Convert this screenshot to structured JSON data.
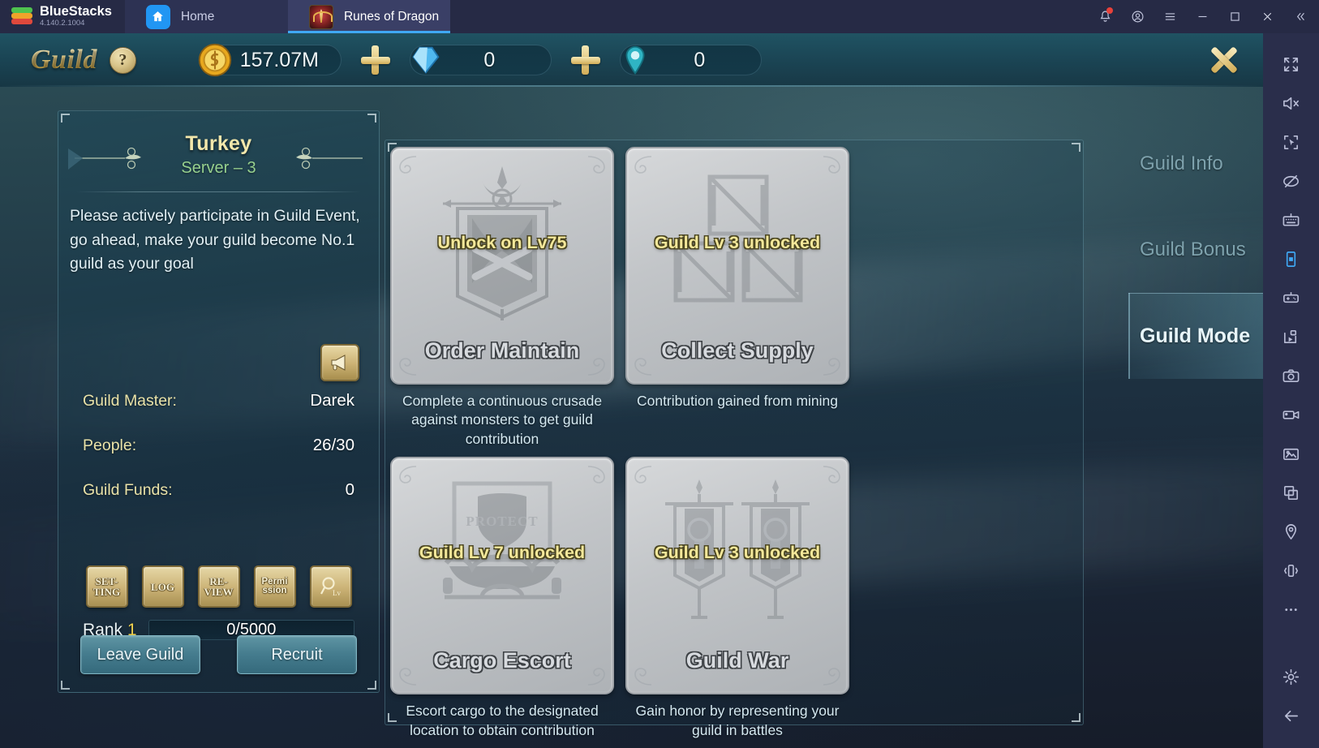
{
  "titlebar": {
    "brand": "BlueStacks",
    "version": "4.140.2.1004",
    "tabs": [
      {
        "label": "Home",
        "icon": "home-icon"
      },
      {
        "label": "Runes of Dragon",
        "icon": "game-app-icon"
      }
    ],
    "controls": [
      {
        "name": "notifications-button",
        "icon": "bell-icon",
        "badge": true
      },
      {
        "name": "account-button",
        "icon": "account-circle-icon"
      },
      {
        "name": "menu-button",
        "icon": "hamburger-icon"
      },
      {
        "name": "minimize-button",
        "icon": "minimize-icon"
      },
      {
        "name": "maximize-button",
        "icon": "maximize-icon"
      },
      {
        "name": "close-button",
        "icon": "close-icon"
      },
      {
        "name": "collapse-button",
        "icon": "double-chevron-left-icon"
      }
    ]
  },
  "game_header": {
    "title": "Guild",
    "help_label": "?",
    "currencies": [
      {
        "name": "gold",
        "icon": "gold-coin-icon",
        "value": "157.07M",
        "add": "+"
      },
      {
        "name": "diamond",
        "icon": "diamond-icon",
        "value": "0",
        "add": "+"
      },
      {
        "name": "gem",
        "icon": "teal-gem-icon",
        "value": "0"
      }
    ],
    "close_label": "X"
  },
  "guild_info": {
    "name": "Turkey",
    "server": "Server – 3",
    "notice": "Please actively participate in Guild Event, go ahead, make your guild become No.1 guild as your goal",
    "announce_icon": "megaphone-icon",
    "stats": [
      {
        "label": "Guild Master:",
        "value": "Darek"
      },
      {
        "label": "People:",
        "value": "26/30"
      },
      {
        "label": "Guild Funds:",
        "value": "0"
      }
    ],
    "function_buttons": [
      {
        "name": "setting-button",
        "line1": "SET-",
        "line2": "TING",
        "icon": null
      },
      {
        "name": "log-button",
        "line1": "LOG",
        "line2": "",
        "icon": null
      },
      {
        "name": "review-button",
        "line1": "RE-",
        "line2": "VIEW",
        "icon": null
      },
      {
        "name": "permission-button",
        "line1": "Permi",
        "line2": "ssion",
        "icon": null
      },
      {
        "name": "level-search-button",
        "line1": "",
        "line2": "",
        "icon": "magnifier-lv-icon"
      }
    ],
    "rank_label": "Rank",
    "rank_value": "1",
    "rank_progress": "0/5000",
    "actions": [
      {
        "name": "leave-guild-button",
        "label": "Leave Guild"
      },
      {
        "name": "recruit-button",
        "label": "Recruit"
      }
    ]
  },
  "guild_modes": [
    {
      "name": "Order Maintain",
      "lock": "Unlock on Lv75",
      "desc": "Complete a continuous crusade against monsters to get guild contribution",
      "icon": "banner-swords-icon"
    },
    {
      "name": "Collect Supply",
      "lock": "Guild Lv 3 unlocked",
      "desc": "Contribution gained from mining",
      "icon": "crates-icon"
    },
    {
      "name": "Cargo Escort",
      "lock": "Guild Lv 7 unlocked",
      "desc": "Escort cargo to the designated location to obtain contribution",
      "icon": "cargo-cart-icon"
    },
    {
      "name": "Guild War",
      "lock": "Guild Lv 3 unlocked",
      "desc": "Gain honor by representing your guild in battles",
      "icon": "twin-banners-icon"
    }
  ],
  "side_tabs": [
    {
      "label": "Guild Info",
      "active": false
    },
    {
      "label": "Guild Bonus",
      "active": false
    },
    {
      "label": "Guild Mode",
      "active": true
    }
  ],
  "toolbar": [
    {
      "name": "fullscreen-button",
      "icon": "fullscreen-icon",
      "selected": false
    },
    {
      "name": "mute-button",
      "icon": "speaker-mute-icon",
      "selected": false
    },
    {
      "name": "aim-button",
      "icon": "crosshair-cursor-icon",
      "selected": false
    },
    {
      "name": "eye-off-button",
      "icon": "eye-off-icon",
      "selected": false
    },
    {
      "name": "keyboard-controls-button",
      "icon": "keyboard-icon",
      "selected": false
    },
    {
      "name": "portrait-view-button",
      "icon": "phone-portrait-icon",
      "selected": true
    },
    {
      "name": "gamepad-button",
      "icon": "gamepad-icon",
      "selected": false
    },
    {
      "name": "script-button",
      "icon": "script-play-icon",
      "selected": false
    },
    {
      "name": "screenshot-button",
      "icon": "camera-icon",
      "selected": false
    },
    {
      "name": "record-button",
      "icon": "video-camera-icon",
      "selected": false
    },
    {
      "name": "media-manager-button",
      "icon": "image-folder-icon",
      "selected": false
    },
    {
      "name": "multi-instance-button",
      "icon": "copy-windows-icon",
      "selected": false
    },
    {
      "name": "location-button",
      "icon": "location-pin-icon",
      "selected": false
    },
    {
      "name": "shake-button",
      "icon": "shake-phone-icon",
      "selected": false
    },
    {
      "name": "more-button",
      "icon": "ellipsis-icon",
      "selected": false
    },
    {
      "name": "settings-button",
      "icon": "gear-icon",
      "selected": false
    },
    {
      "name": "back-button",
      "icon": "arrow-left-icon",
      "selected": false
    }
  ],
  "colors": {
    "accent_blue": "#3fa9f5",
    "gold": "#f2e7ab",
    "green": "#96d08e",
    "lock_yellow": "#f4e89a"
  }
}
